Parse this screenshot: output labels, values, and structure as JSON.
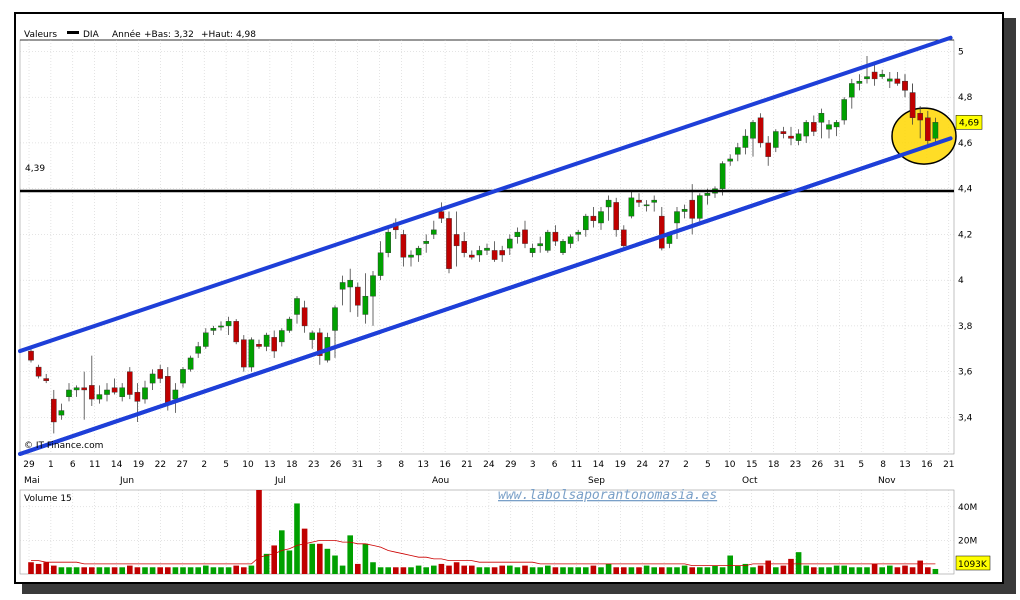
{
  "chart_data": [
    {
      "type": "candlestick",
      "legend_prefix": "Valeurs",
      "series_name": "DIA",
      "header_period": "Année",
      "header_low_label": "+Bas: 3,32",
      "header_high_label": "+Haut: 4,98",
      "y_ticks": [
        "3,4",
        "3,6",
        "3,8",
        "4",
        "4,2",
        "4,4",
        "4,6",
        "4,8",
        "5"
      ],
      "y_tick_values": [
        3.4,
        3.6,
        3.8,
        4.0,
        4.2,
        4.4,
        4.6,
        4.8,
        5.0
      ],
      "ylim": [
        3.24,
        5.05
      ],
      "last_price_label": "4,69",
      "last_price": 4.69,
      "support_label": "4,39",
      "support_value": 4.39,
      "x_tick_labels": [
        "29",
        "1",
        "6",
        "11",
        "14",
        "19",
        "22",
        "27",
        "2",
        "5",
        "10",
        "13",
        "18",
        "23",
        "26",
        "31",
        "3",
        "8",
        "13",
        "16",
        "21",
        "24",
        "29",
        "3",
        "6",
        "11",
        "14",
        "19",
        "24",
        "27",
        "2",
        "5",
        "10",
        "15",
        "18",
        "23",
        "26",
        "31",
        "5",
        "8",
        "13",
        "16",
        "21"
      ],
      "month_labels": [
        "Mai",
        "Jun",
        "Jul",
        "Aou",
        "Sep",
        "Oct",
        "Nov"
      ],
      "copyright": "© IT Finance.com",
      "watermark": "www.labolsaporantonomasia.es",
      "candles": [
        [
          3.69,
          3.71,
          3.64,
          3.65
        ],
        [
          3.62,
          3.63,
          3.57,
          3.58
        ],
        [
          3.57,
          3.59,
          3.55,
          3.56
        ],
        [
          3.48,
          3.52,
          3.33,
          3.38
        ],
        [
          3.41,
          3.46,
          3.39,
          3.43
        ],
        [
          3.49,
          3.55,
          3.47,
          3.52
        ],
        [
          3.52,
          3.54,
          3.49,
          3.53
        ],
        [
          3.53,
          3.6,
          3.39,
          3.52
        ],
        [
          3.54,
          3.67,
          3.45,
          3.48
        ],
        [
          3.48,
          3.54,
          3.46,
          3.5
        ],
        [
          3.5,
          3.55,
          3.47,
          3.52
        ],
        [
          3.53,
          3.57,
          3.5,
          3.51
        ],
        [
          3.49,
          3.55,
          3.47,
          3.53
        ],
        [
          3.6,
          3.62,
          3.48,
          3.5
        ],
        [
          3.51,
          3.55,
          3.38,
          3.47
        ],
        [
          3.48,
          3.56,
          3.46,
          3.53
        ],
        [
          3.55,
          3.61,
          3.52,
          3.59
        ],
        [
          3.61,
          3.63,
          3.55,
          3.57
        ],
        [
          3.58,
          3.62,
          3.43,
          3.46
        ],
        [
          3.48,
          3.55,
          3.42,
          3.52
        ],
        [
          3.55,
          3.62,
          3.53,
          3.61
        ],
        [
          3.61,
          3.67,
          3.6,
          3.66
        ],
        [
          3.68,
          3.73,
          3.66,
          3.71
        ],
        [
          3.71,
          3.79,
          3.7,
          3.77
        ],
        [
          3.78,
          3.8,
          3.76,
          3.79
        ],
        [
          3.8,
          3.82,
          3.78,
          3.8
        ],
        [
          3.8,
          3.84,
          3.76,
          3.82
        ],
        [
          3.82,
          3.83,
          3.72,
          3.73
        ],
        [
          3.74,
          3.76,
          3.6,
          3.62
        ],
        [
          3.62,
          3.75,
          3.6,
          3.74
        ],
        [
          3.72,
          3.74,
          3.7,
          3.71
        ],
        [
          3.71,
          3.77,
          3.69,
          3.76
        ],
        [
          3.75,
          3.78,
          3.66,
          3.69
        ],
        [
          3.73,
          3.79,
          3.71,
          3.78
        ],
        [
          3.78,
          3.84,
          3.77,
          3.83
        ],
        [
          3.85,
          3.93,
          3.81,
          3.92
        ],
        [
          3.88,
          3.91,
          3.77,
          3.8
        ],
        [
          3.74,
          3.78,
          3.7,
          3.77
        ],
        [
          3.77,
          3.79,
          3.63,
          3.67
        ],
        [
          3.65,
          3.77,
          3.64,
          3.75
        ],
        [
          3.78,
          3.89,
          3.66,
          3.88
        ],
        [
          3.96,
          4.02,
          3.89,
          3.99
        ],
        [
          3.97,
          4.05,
          3.86,
          4.0
        ],
        [
          3.97,
          3.99,
          3.84,
          3.89
        ],
        [
          3.85,
          4.03,
          3.81,
          3.93
        ],
        [
          3.93,
          4.04,
          3.8,
          4.02
        ],
        [
          4.02,
          4.17,
          4.0,
          4.12
        ],
        [
          4.12,
          4.23,
          4.1,
          4.21
        ],
        [
          4.25,
          4.27,
          4.18,
          4.22
        ],
        [
          4.2,
          4.22,
          4.06,
          4.1
        ],
        [
          4.1,
          4.13,
          4.06,
          4.11
        ],
        [
          4.11,
          4.15,
          4.08,
          4.14
        ],
        [
          4.16,
          4.2,
          4.12,
          4.17
        ],
        [
          4.2,
          4.26,
          4.18,
          4.22
        ],
        [
          4.3,
          4.34,
          4.25,
          4.27
        ],
        [
          4.27,
          4.3,
          4.03,
          4.05
        ],
        [
          4.2,
          4.3,
          4.06,
          4.15
        ],
        [
          4.17,
          4.21,
          4.1,
          4.12
        ],
        [
          4.11,
          4.13,
          4.09,
          4.1
        ],
        [
          4.11,
          4.15,
          4.08,
          4.13
        ],
        [
          4.13,
          4.16,
          4.11,
          4.14
        ],
        [
          4.13,
          4.17,
          4.08,
          4.09
        ],
        [
          4.13,
          4.15,
          4.08,
          4.11
        ],
        [
          4.14,
          4.2,
          4.11,
          4.18
        ],
        [
          4.19,
          4.23,
          4.16,
          4.21
        ],
        [
          4.22,
          4.26,
          4.14,
          4.16
        ],
        [
          4.12,
          4.16,
          4.1,
          4.14
        ],
        [
          4.15,
          4.19,
          4.12,
          4.16
        ],
        [
          4.13,
          4.22,
          4.12,
          4.21
        ],
        [
          4.21,
          4.24,
          4.15,
          4.17
        ],
        [
          4.12,
          4.18,
          4.11,
          4.17
        ],
        [
          4.16,
          4.2,
          4.14,
          4.19
        ],
        [
          4.2,
          4.22,
          4.17,
          4.21
        ],
        [
          4.22,
          4.29,
          4.19,
          4.28
        ],
        [
          4.28,
          4.32,
          4.23,
          4.26
        ],
        [
          4.25,
          4.32,
          4.22,
          4.3
        ],
        [
          4.32,
          4.37,
          4.26,
          4.35
        ],
        [
          4.34,
          4.36,
          4.19,
          4.22
        ],
        [
          4.22,
          4.24,
          4.14,
          4.15
        ],
        [
          4.28,
          4.39,
          4.27,
          4.36
        ],
        [
          4.35,
          4.38,
          4.32,
          4.34
        ],
        [
          4.33,
          4.35,
          4.3,
          4.33
        ],
        [
          4.34,
          4.37,
          4.3,
          4.35
        ],
        [
          4.28,
          4.32,
          4.13,
          4.14
        ],
        [
          4.16,
          4.21,
          4.14,
          4.2
        ],
        [
          4.25,
          4.32,
          4.18,
          4.3
        ],
        [
          4.3,
          4.33,
          4.27,
          4.31
        ],
        [
          4.35,
          4.42,
          4.2,
          4.27
        ],
        [
          4.27,
          4.38,
          4.25,
          4.37
        ],
        [
          4.37,
          4.4,
          4.33,
          4.38
        ],
        [
          4.38,
          4.41,
          4.36,
          4.4
        ],
        [
          4.4,
          4.52,
          4.37,
          4.51
        ],
        [
          4.52,
          4.55,
          4.5,
          4.53
        ],
        [
          4.55,
          4.6,
          4.52,
          4.58
        ],
        [
          4.58,
          4.66,
          4.55,
          4.63
        ],
        [
          4.62,
          4.7,
          4.54,
          4.69
        ],
        [
          4.71,
          4.73,
          4.58,
          4.6
        ],
        [
          4.6,
          4.63,
          4.5,
          4.54
        ],
        [
          4.58,
          4.66,
          4.56,
          4.65
        ],
        [
          4.65,
          4.67,
          4.62,
          4.64
        ],
        [
          4.63,
          4.67,
          4.59,
          4.62
        ],
        [
          4.61,
          4.66,
          4.59,
          4.64
        ],
        [
          4.63,
          4.7,
          4.6,
          4.69
        ],
        [
          4.69,
          4.72,
          4.63,
          4.65
        ],
        [
          4.69,
          4.75,
          4.62,
          4.73
        ],
        [
          4.66,
          4.7,
          4.62,
          4.68
        ],
        [
          4.67,
          4.7,
          4.63,
          4.69
        ],
        [
          4.7,
          4.8,
          4.68,
          4.79
        ],
        [
          4.8,
          4.88,
          4.75,
          4.86
        ],
        [
          4.86,
          4.9,
          4.83,
          4.87
        ],
        [
          4.88,
          4.98,
          4.86,
          4.89
        ],
        [
          4.91,
          4.94,
          4.85,
          4.88
        ],
        [
          4.89,
          4.92,
          4.88,
          4.9
        ],
        [
          4.87,
          4.91,
          4.84,
          4.88
        ],
        [
          4.88,
          4.91,
          4.85,
          4.86
        ],
        [
          4.87,
          4.9,
          4.8,
          4.83
        ],
        [
          4.82,
          4.86,
          4.68,
          4.71
        ],
        [
          4.73,
          4.76,
          4.62,
          4.7
        ],
        [
          4.71,
          4.74,
          4.59,
          4.61
        ],
        [
          4.62,
          4.71,
          4.6,
          4.69
        ]
      ],
      "channel_lines": [
        {
          "name": "upper",
          "start": [
            0,
            3.69
          ],
          "end": [
            121,
            5.06
          ]
        },
        {
          "name": "lower",
          "start": [
            0,
            3.24
          ],
          "end": [
            121,
            4.62
          ]
        }
      ],
      "highlight_circle_center": [
        117.5,
        4.63
      ],
      "volume": {
        "label": "Volume 15",
        "y_ticks": [
          "20M",
          "40M"
        ],
        "y_tick_values": [
          20,
          40
        ],
        "ylim": [
          0,
          50
        ],
        "last_label": "1093K",
        "values": [
          7,
          6,
          7,
          5,
          4,
          4,
          4,
          4,
          4,
          4,
          4,
          4,
          4,
          5,
          4,
          4,
          4,
          4,
          4,
          4,
          4,
          4,
          4,
          5,
          4,
          4,
          4,
          5,
          4,
          5,
          50,
          12,
          17,
          26,
          14,
          42,
          27,
          18,
          18,
          15,
          11,
          5,
          23,
          6,
          18,
          7,
          4,
          4,
          4,
          4,
          4,
          5,
          4,
          5,
          6,
          5,
          7,
          5,
          5,
          4,
          4,
          4,
          5,
          5,
          4,
          5,
          4,
          4,
          5,
          4,
          4,
          4,
          4,
          4,
          5,
          4,
          6,
          4,
          4,
          4,
          4,
          5,
          4,
          4,
          4,
          4,
          5,
          4,
          4,
          4,
          5,
          4,
          11,
          5,
          6,
          4,
          5,
          8,
          4,
          5,
          9,
          13,
          5,
          4,
          4,
          4,
          5,
          5,
          4,
          4,
          4,
          6,
          4,
          5,
          4,
          5,
          4,
          8,
          4,
          3,
          1
        ],
        "ma": [
          8,
          8,
          7,
          7,
          7,
          7,
          7,
          6,
          6,
          6,
          6,
          6,
          6,
          6,
          6,
          6,
          6,
          6,
          6,
          6,
          6,
          6,
          6,
          6,
          6,
          6,
          6,
          6,
          6,
          6,
          10,
          11,
          12,
          14,
          15,
          17,
          18,
          19,
          20,
          20,
          20,
          19,
          19,
          18,
          18,
          17,
          16,
          14,
          13,
          12,
          11,
          10,
          10,
          9,
          9,
          8,
          8,
          8,
          8,
          7,
          7,
          7,
          7,
          7,
          7,
          7,
          7,
          6,
          6,
          6,
          6,
          6,
          6,
          6,
          6,
          6,
          6,
          6,
          6,
          6,
          6,
          6,
          6,
          6,
          6,
          6,
          6,
          5,
          5,
          5,
          5,
          5,
          5,
          5,
          5,
          6,
          6,
          6,
          6,
          6,
          6,
          6,
          6,
          6,
          6,
          6,
          6,
          6,
          6,
          6,
          6,
          6,
          6,
          6,
          6,
          6,
          6,
          6,
          6,
          6,
          6
        ]
      }
    }
  ],
  "colors": {
    "up": "#00a000",
    "down": "#c00000",
    "channel": "#1e3fd8",
    "support": "#000000",
    "highlight_fill": "#ffd700",
    "price_tag": "#ffff00",
    "ma_line": "#cc0000",
    "grid": "#c8c8c8",
    "watermark": "#7aa0c8"
  }
}
